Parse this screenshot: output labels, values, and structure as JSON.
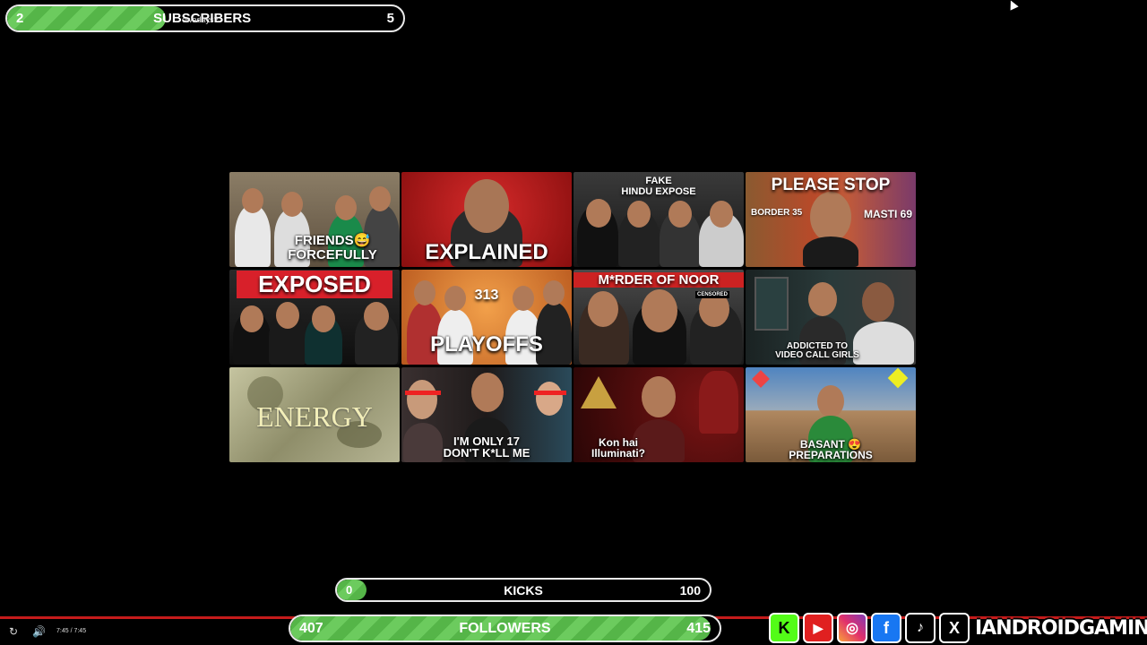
{
  "subscribers_goal": {
    "start": "2",
    "label": "SUBSCRIBERS",
    "end": "5",
    "overlay_text": "owadays?",
    "progress": 0.4
  },
  "kicks_goal": {
    "start": "0",
    "label": "KICKS",
    "end": "100",
    "progress": 0.08
  },
  "followers_goal": {
    "start": "407",
    "label": "FOLLOWERS",
    "end": "415",
    "progress": 0.98
  },
  "thumbnails": [
    {
      "top": "",
      "caption": "FRIENDS😅\nFORCEFULLY",
      "bg": "#7a6a55"
    },
    {
      "top": "",
      "caption": "EXPLAINED",
      "bg": "#b11a1a"
    },
    {
      "top": "FAKE\nHINDU EXPOSE",
      "caption": "",
      "bg": "#2a2a2a"
    },
    {
      "top": "PLEASE STOP",
      "caption": "BORDER 35   MASTI 69",
      "bg": "#b24a2a"
    },
    {
      "top": "EXPOSED",
      "caption": "",
      "bg": "#1a1a1a"
    },
    {
      "top": "313",
      "caption": "PLAYOFFS",
      "bg": "#d07a2a"
    },
    {
      "top": "M*RDER OF NOOR",
      "caption": "CENSORED",
      "bg": "#2d2d2d"
    },
    {
      "top": "",
      "caption": "ADDICTED TO\nVIDEO CALL GIRLS",
      "bg": "#1f2a2a"
    },
    {
      "top": "",
      "caption": "ENERGY",
      "bg": "#a8a880"
    },
    {
      "top": "",
      "caption": "I'M ONLY 17\nDON'T K*LL ME",
      "bg": "#3a2222"
    },
    {
      "top": "",
      "caption": "Kon hai\nIlluminati?",
      "bg": "#5a1010"
    },
    {
      "top": "",
      "caption": "BASANT 😍\nPREPARATIONS",
      "bg": "#4a7ab5"
    }
  ],
  "player": {
    "time": "7:45 / 7:45"
  },
  "social": {
    "icons": [
      "kick-icon",
      "youtube-icon",
      "instagram-icon",
      "facebook-icon",
      "tiktok-icon",
      "x-icon"
    ],
    "handle": "IANDROIDGAMING"
  }
}
